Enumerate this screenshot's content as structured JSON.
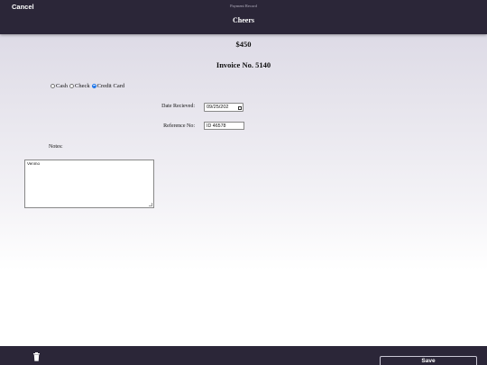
{
  "header": {
    "cancel_label": "Cancel",
    "small_title": "Payment Record",
    "title": "Cheers"
  },
  "summary": {
    "amount": "$450",
    "invoice": "Invoice No. 5140"
  },
  "payment_methods": {
    "options": [
      "Cash",
      "Check",
      "Credit Card"
    ],
    "selected": "Credit Card"
  },
  "form": {
    "date_label": "Date Recieved:",
    "date_value": "09/25/202",
    "reference_label": "Reference No:",
    "reference_value": "ID 46578",
    "notes_label": "Notes:",
    "notes_value": "Venmo"
  },
  "footer": {
    "delete_icon": "trash-icon",
    "save_label": "Save"
  },
  "colors": {
    "bar_background": "#2b2638",
    "radio_accent": "#1a73e8"
  }
}
